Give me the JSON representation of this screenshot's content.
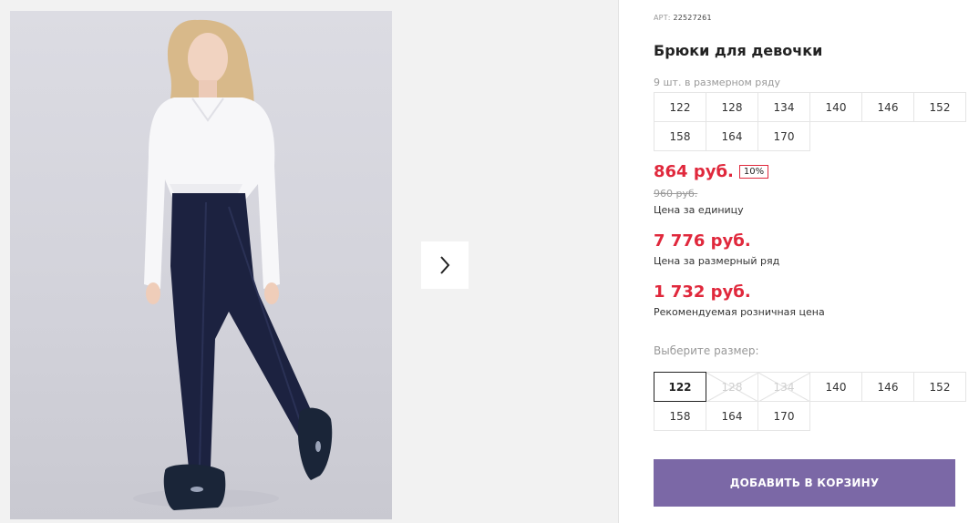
{
  "product": {
    "art_label": "АРТ:",
    "art_number": "22527261",
    "title": "Брюки для девочки",
    "pack_note": "9 шт. в размерном ряду",
    "pack_sizes": [
      "122",
      "128",
      "134",
      "140",
      "146",
      "152",
      "158",
      "164",
      "170"
    ]
  },
  "prices": {
    "unit_price": "864 руб.",
    "discount_badge": "10%",
    "old_price": "960 руб.",
    "unit_note": "Цена за единицу",
    "row_price": "7 776 руб.",
    "row_note": "Цена за размерный ряд",
    "retail_price": "1 732 руб.",
    "retail_note": "Рекомендуемая розничная цена"
  },
  "size_picker": {
    "label": "Выберите размер:",
    "sizes": [
      {
        "label": "122",
        "state": "selected"
      },
      {
        "label": "128",
        "state": "disabled"
      },
      {
        "label": "134",
        "state": "disabled"
      },
      {
        "label": "140",
        "state": "available"
      },
      {
        "label": "146",
        "state": "available"
      },
      {
        "label": "152",
        "state": "available"
      },
      {
        "label": "158",
        "state": "available"
      },
      {
        "label": "164",
        "state": "available"
      },
      {
        "label": "170",
        "state": "available"
      }
    ]
  },
  "cart": {
    "add_label": "ДОБАВИТЬ В КОРЗИНУ"
  },
  "colors": {
    "accent": "#7b68a6",
    "price_red": "#e0283c"
  },
  "gallery": {
    "next_icon": "chevron-right-icon"
  }
}
